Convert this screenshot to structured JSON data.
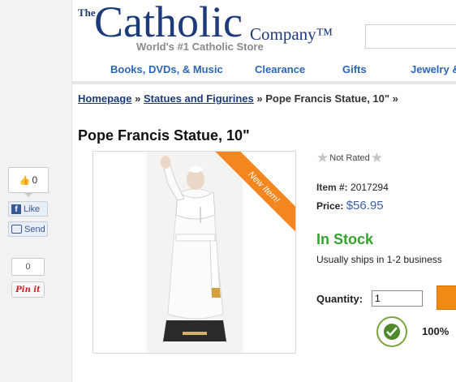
{
  "social": {
    "fb_count": "0",
    "like_label": "Like",
    "send_label": "Send",
    "pin_count": "0",
    "pin_label": "Pin it"
  },
  "logo": {
    "the": "The",
    "catholic": "Catholic",
    "company": "Company™",
    "tagline": "World's #1 Catholic Store"
  },
  "nav": {
    "items": [
      "Books, DVDs, & Music",
      "Clearance",
      "Gifts",
      "Jewelry &"
    ]
  },
  "breadcrumb": {
    "home": "Homepage",
    "sep1": " » ",
    "category": "Statues and Figurines",
    "sep2": " » ",
    "current": "Pope Francis Statue, 10\" »"
  },
  "product": {
    "title": "Pope Francis Statue, 10\"",
    "badge": "New Item!",
    "rating_text": "Not Rated",
    "item_label": "Item #:",
    "item_number": "2017294",
    "price_label": "Price:",
    "price": "$56.95",
    "stock": "In Stock",
    "ships": "Usually ships in 1-2 business",
    "quantity_label": "Quantity:",
    "quantity_value": "1",
    "guarantee": "100%"
  },
  "colors": {
    "brand_blue": "#1d3a7a",
    "link_blue": "#2a66b6",
    "in_stock_green": "#34a32e",
    "accent_orange": "#f08a12"
  }
}
